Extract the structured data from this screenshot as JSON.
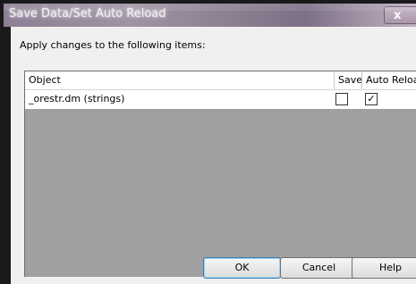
{
  "window": {
    "title": "Save Data/Set Auto Reload",
    "close_label": "x"
  },
  "dialog": {
    "prompt": "Apply changes to the following items:"
  },
  "table": {
    "columns": [
      "Object",
      "Save",
      "Auto Reload"
    ],
    "rows": [
      {
        "object": "_orestr.dm (strings)",
        "save": false,
        "auto_reload": true,
        "save_mark": "",
        "auto_reload_mark": "✓"
      }
    ]
  },
  "buttons": {
    "ok": "OK",
    "cancel": "Cancel",
    "help": "Help"
  }
}
